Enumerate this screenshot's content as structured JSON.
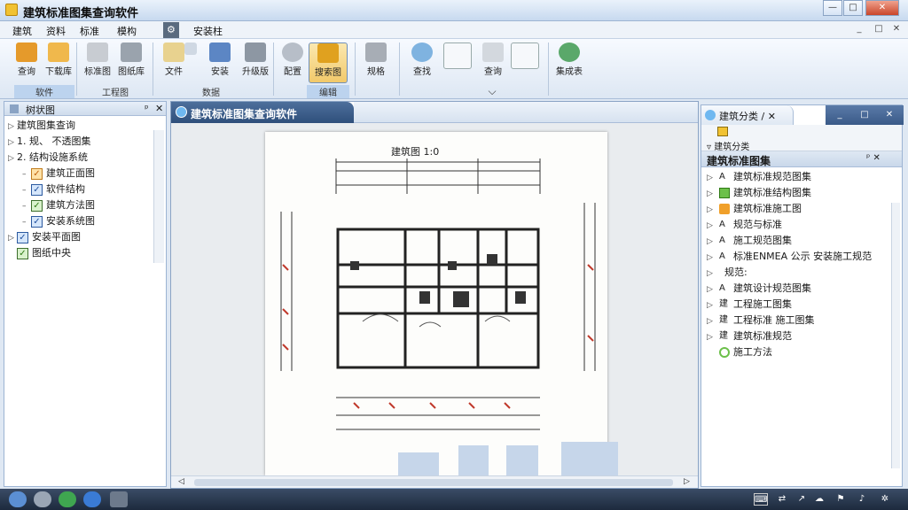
{
  "window": {
    "title": "建筑标准图集查询软件",
    "controls": {
      "minimize": "—",
      "maximize": "□",
      "close": "✕"
    }
  },
  "menubar": {
    "items": [
      "建筑",
      "资料",
      "标准",
      "模构",
      "安装柱"
    ],
    "mdi_controls": {
      "minimize": "_",
      "restore": "□",
      "close": "✕"
    }
  },
  "ribbon": {
    "groups": [
      {
        "label": "软件",
        "buttons": [
          "查询",
          "下载库"
        ]
      },
      {
        "label": "工程图",
        "buttons": [
          "标准图",
          "图纸库"
        ]
      },
      {
        "label": "数据",
        "buttons": [
          "文件",
          "",
          "安装",
          "升级版"
        ]
      },
      {
        "label": "编辑",
        "buttons": [
          "配置",
          "搜索图"
        ]
      },
      {
        "label": "",
        "buttons": [
          "规格",
          "查找",
          "",
          "查询",
          "",
          "集成表"
        ]
      }
    ]
  },
  "left_panel": {
    "title": "树状图",
    "pin": "ᵖ",
    "close": "✕",
    "items": [
      {
        "indent": 0,
        "expander": "▷",
        "label": "建筑图集查询"
      },
      {
        "indent": 0,
        "expander": "▷",
        "label": "1. 规、 不透图集"
      },
      {
        "indent": 0,
        "expander": "▷",
        "label": "2. 结构设施系统"
      },
      {
        "indent": 1,
        "expander": "–",
        "check": "orange",
        "label": "建筑正面图"
      },
      {
        "indent": 1,
        "expander": "–",
        "check": "blue",
        "label": "软件结构"
      },
      {
        "indent": 1,
        "expander": "–",
        "check": "green",
        "label": "建筑方法图"
      },
      {
        "indent": 1,
        "expander": "–",
        "check": "blue",
        "label": "安装系统图"
      },
      {
        "indent": 0,
        "expander": "▷",
        "check": "blue",
        "label": "安装平面图"
      },
      {
        "indent": 0,
        "expander": "",
        "check": "green",
        "label": "图纸中央"
      }
    ]
  },
  "document": {
    "tab_title": "建筑标准图集查询软件",
    "drawing_title": "建筑图 1:0"
  },
  "right_panel": {
    "tab_label": "建筑分类 / ✕",
    "subtoolbar_label": "建筑分类",
    "header": "建筑标准图集",
    "header_controls": "ᵖ ✕",
    "items": [
      {
        "expander": "▷",
        "icon": "text",
        "icon_text": "A",
        "label": "建筑标准规范图集"
      },
      {
        "expander": "▷",
        "icon": "green",
        "label": "建筑标准结构图集"
      },
      {
        "expander": "▷",
        "icon": "orange",
        "label": "建筑标准施工图"
      },
      {
        "expander": "▷",
        "icon": "text",
        "icon_text": "A",
        "label": "规范与标准"
      },
      {
        "expander": "▷",
        "icon": "text",
        "icon_text": "A",
        "label": "施工规范图集"
      },
      {
        "expander": "▷",
        "icon": "text",
        "icon_text": "A",
        "label": "标准ENMEA 公示 安装施工规范"
      },
      {
        "expander": "▷",
        "icon": "none",
        "label": "规范:"
      },
      {
        "expander": "▷",
        "icon": "text",
        "icon_text": "A",
        "label": "建筑设计规范图集"
      },
      {
        "expander": "▷",
        "icon": "text",
        "icon_text": "建",
        "label": "工程施工图集"
      },
      {
        "expander": "▷",
        "icon": "text",
        "icon_text": "建",
        "label": "工程标准 施工图集"
      },
      {
        "expander": "▷",
        "icon": "text",
        "icon_text": "建",
        "label": "建筑标准规范"
      },
      {
        "expander": "",
        "icon": "ring",
        "label": "施工方法"
      }
    ]
  },
  "colors": {
    "accent": "#2f4f7b",
    "selection": "#f2c96a",
    "taskbar": "#1d2a3d"
  }
}
